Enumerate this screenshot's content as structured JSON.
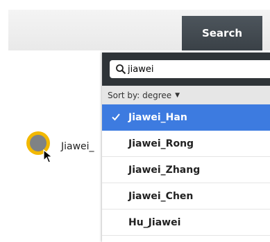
{
  "header": {
    "search_tab_label": "Search"
  },
  "graph": {
    "node_label": "Jiawei_"
  },
  "search": {
    "query": "jiawei"
  },
  "sort": {
    "label": "Sort by: degree"
  },
  "results": [
    {
      "label": "Jiawei_Han",
      "selected": true
    },
    {
      "label": "Jiawei_Rong",
      "selected": false
    },
    {
      "label": "Jiawei_Zhang",
      "selected": false
    },
    {
      "label": "Jiawei_Chen",
      "selected": false
    },
    {
      "label": "Hu_Jiawei",
      "selected": false
    }
  ],
  "colors": {
    "accent": "#3d7be0",
    "node": "#f2b800",
    "panel": "#2f3438"
  }
}
